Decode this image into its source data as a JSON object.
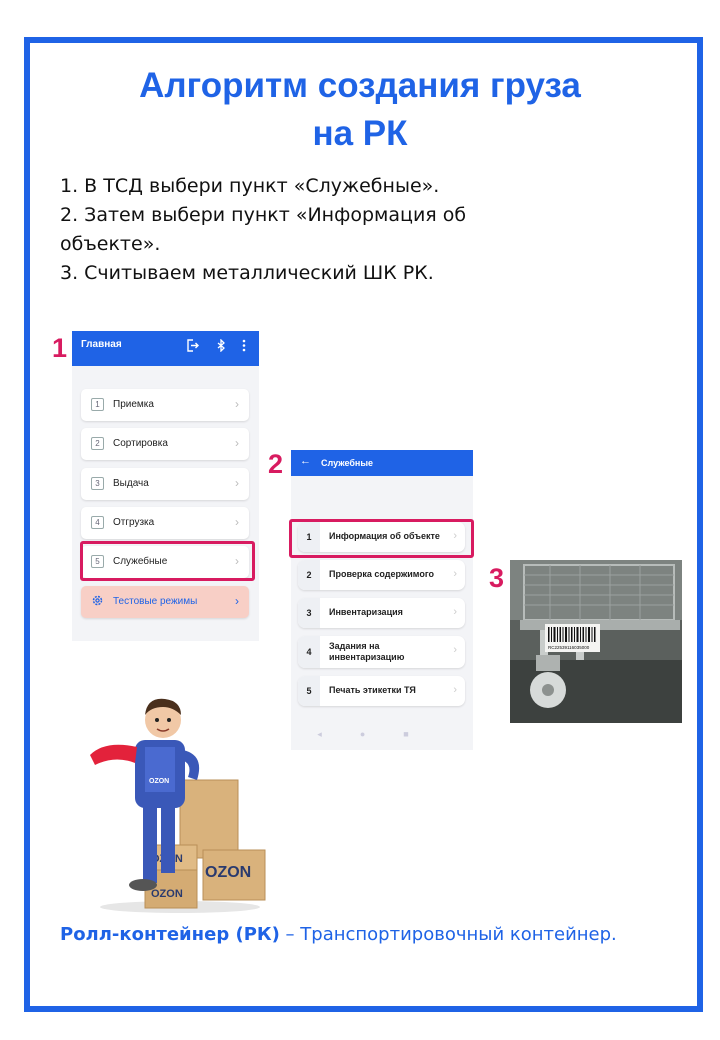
{
  "title_line1": "Алгоритм создания груза",
  "title_line2": "на РК",
  "steps": [
    "1. В ТСД выбери пункт «Служебные».",
    "2. Затем выбери пункт «Информация об объекте».",
    "3. Считываем металлический ШК РК."
  ],
  "labels": {
    "one": "1",
    "two": "2",
    "three": "3"
  },
  "phone1": {
    "title": "Главная",
    "items": [
      {
        "n": "1",
        "label": "Приемка"
      },
      {
        "n": "2",
        "label": "Сортировка"
      },
      {
        "n": "3",
        "label": "Выдача"
      },
      {
        "n": "4",
        "label": "Отгрузка"
      },
      {
        "n": "5",
        "label": "Служебные"
      }
    ],
    "test_modes": "Тестовые режимы"
  },
  "phone2": {
    "title": "Служебные",
    "items": [
      {
        "n": "1",
        "label": "Информация об объекте"
      },
      {
        "n": "2",
        "label": "Проверка содержимого"
      },
      {
        "n": "3",
        "label": "Инвентаризация"
      },
      {
        "n": "4",
        "label": "Задания на инвентаризацию"
      },
      {
        "n": "5",
        "label": "Печать этикетки ТЯ"
      }
    ]
  },
  "barcode_text": "RC22539116035000",
  "courier_brand": "OZON",
  "definition": {
    "term": "Ролл-контейнер (РК)",
    "text": " – Транспортировочный контейнер."
  },
  "colors": {
    "accent": "#1f63e6",
    "highlight": "#d81b60",
    "pink_item": "#f8cfc6"
  }
}
